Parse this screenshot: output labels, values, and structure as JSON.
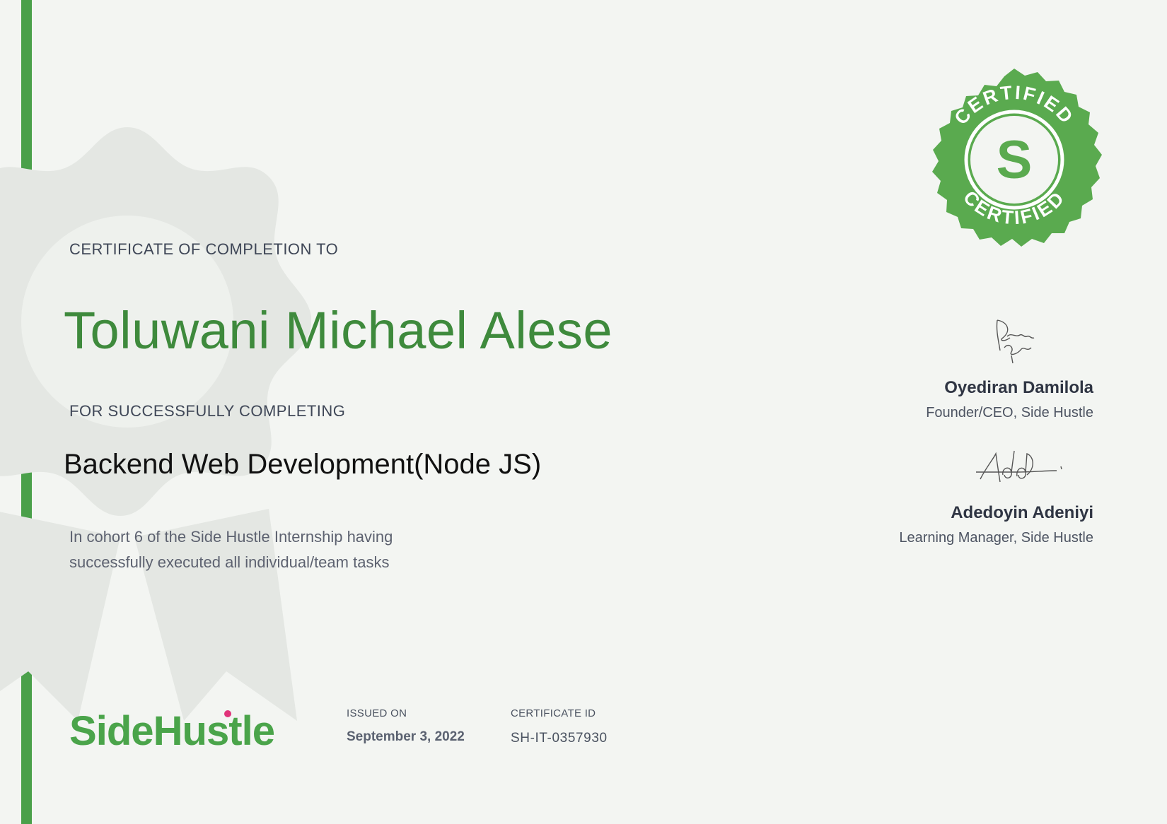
{
  "certificate": {
    "heading": "CERTIFICATE OF COMPLETION TO",
    "recipient_name": "Toluwani Michael Alese",
    "completion_label": "FOR SUCCESSFULLY COMPLETING",
    "course_title": "Backend Web Development(Node JS)",
    "description_line1": "In cohort 6 of the Side Hustle Internship having",
    "description_line2": "successfully executed all individual/team tasks"
  },
  "seal": {
    "top_text": "CERTIFIED",
    "bottom_text": "CERTIFIED",
    "letter": "S",
    "color": "#5aaa4f"
  },
  "signatories": [
    {
      "name": "Oyediran Damilola",
      "role": "Founder/CEO, Side Hustle"
    },
    {
      "name": "Adedoyin Adeniyi",
      "role": "Learning Manager, Side Hustle"
    }
  ],
  "footer": {
    "logo_text": "SideHustle",
    "logo_color": "#4aa44a",
    "logo_dot_color": "#e0337a",
    "issued_label": "ISSUED ON",
    "issued_date": "September 3, 2022",
    "id_label": "CERTIFICATE ID",
    "id_value": "SH-IT-0357930"
  },
  "colors": {
    "accent_bar": "#4aa04a",
    "name_green": "#3e8a3c",
    "background": "#f3f5f2"
  }
}
